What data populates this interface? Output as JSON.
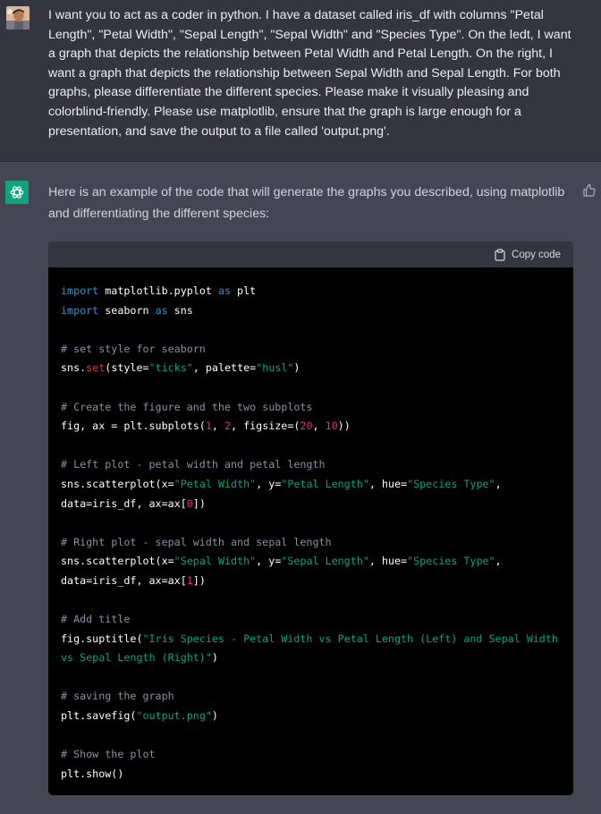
{
  "user_message": {
    "avatar": "user-avatar-photo",
    "lines": [
      "I want you to act as a coder in python. I have a dataset called iris_df with columns \"Petal",
      "Length\", \"Petal Width\", \"Sepal Length\", \"Sepal Width\" and \"Species Type\". On the ledt, I want",
      "a graph that depicts the relationship between Petal Width and Petal Length. On the right, I",
      "want a graph that depicts the relationship between Sepal Width and Sepal Length. For both",
      "graphs, please differentiate the different species. Please make it visually pleasing and",
      "colorblind-friendly. Please use matplotlib, ensure that the graph is large enough for a",
      "presentation, and save the output to a file called 'output.png'."
    ]
  },
  "assistant_message": {
    "avatar": "openai-logo-icon",
    "accent_color": "#10a37f",
    "intro_lines": [
      "Here is an example of the code that will generate the graphs you described, using matplotlib",
      "and differentiating the different species:"
    ],
    "feedback_icon": "thumbs-up-icon"
  },
  "code_block": {
    "copy_label": "Copy code",
    "copy_icon": "clipboard-icon",
    "lines": [
      [
        {
          "t": "import",
          "c": "kw"
        },
        {
          "t": " matplotlib.pyplot "
        },
        {
          "t": "as",
          "c": "kw"
        },
        {
          "t": " plt"
        }
      ],
      [
        {
          "t": "import",
          "c": "kw"
        },
        {
          "t": " seaborn "
        },
        {
          "t": "as",
          "c": "kw"
        },
        {
          "t": " sns"
        }
      ],
      [],
      [
        {
          "t": "# set style for seaborn",
          "c": "com"
        }
      ],
      [
        {
          "t": "sns."
        },
        {
          "t": "set",
          "c": "fn"
        },
        {
          "t": "(style="
        },
        {
          "t": "\"ticks\"",
          "c": "str"
        },
        {
          "t": ", palette="
        },
        {
          "t": "\"husl\"",
          "c": "str"
        },
        {
          "t": ")"
        }
      ],
      [],
      [
        {
          "t": "# Create the figure and the two subplots",
          "c": "com"
        }
      ],
      [
        {
          "t": "fig, ax = plt.subplots("
        },
        {
          "t": "1",
          "c": "num"
        },
        {
          "t": ", "
        },
        {
          "t": "2",
          "c": "num"
        },
        {
          "t": ", figsize=("
        },
        {
          "t": "20",
          "c": "num"
        },
        {
          "t": ", "
        },
        {
          "t": "10",
          "c": "num"
        },
        {
          "t": "))"
        }
      ],
      [],
      [
        {
          "t": "# Left plot - petal width and petal length",
          "c": "com"
        }
      ],
      [
        {
          "t": "sns.scatterplot(x="
        },
        {
          "t": "\"Petal Width\"",
          "c": "str"
        },
        {
          "t": ", y="
        },
        {
          "t": "\"Petal Length\"",
          "c": "str"
        },
        {
          "t": ", hue="
        },
        {
          "t": "\"Species Type\"",
          "c": "str"
        },
        {
          "t": ","
        }
      ],
      [
        {
          "t": "data=iris_df, ax=ax["
        },
        {
          "t": "0",
          "c": "num"
        },
        {
          "t": "])"
        }
      ],
      [],
      [
        {
          "t": "# Right plot - sepal width and sepal length",
          "c": "com"
        }
      ],
      [
        {
          "t": "sns.scatterplot(x="
        },
        {
          "t": "\"Sepal Width\"",
          "c": "str"
        },
        {
          "t": ", y="
        },
        {
          "t": "\"Sepal Length\"",
          "c": "str"
        },
        {
          "t": ", hue="
        },
        {
          "t": "\"Species Type\"",
          "c": "str"
        },
        {
          "t": ","
        }
      ],
      [
        {
          "t": "data=iris_df, ax=ax["
        },
        {
          "t": "1",
          "c": "num"
        },
        {
          "t": "])"
        }
      ],
      [],
      [
        {
          "t": "# Add title",
          "c": "com"
        }
      ],
      [
        {
          "t": "fig.suptitle("
        },
        {
          "t": "\"Iris Species - Petal Width vs Petal Length (Left) and Sepal Width",
          "c": "str"
        }
      ],
      [
        {
          "t": "vs Sepal Length (Right)\"",
          "c": "str"
        },
        {
          "t": ")"
        }
      ],
      [],
      [
        {
          "t": "# saving the graph",
          "c": "com"
        }
      ],
      [
        {
          "t": "plt.savefig("
        },
        {
          "t": "\"output.png\"",
          "c": "str"
        },
        {
          "t": ")"
        }
      ],
      [],
      [
        {
          "t": "# Show the plot",
          "c": "com"
        }
      ],
      [
        {
          "t": "plt.show()"
        }
      ]
    ]
  }
}
